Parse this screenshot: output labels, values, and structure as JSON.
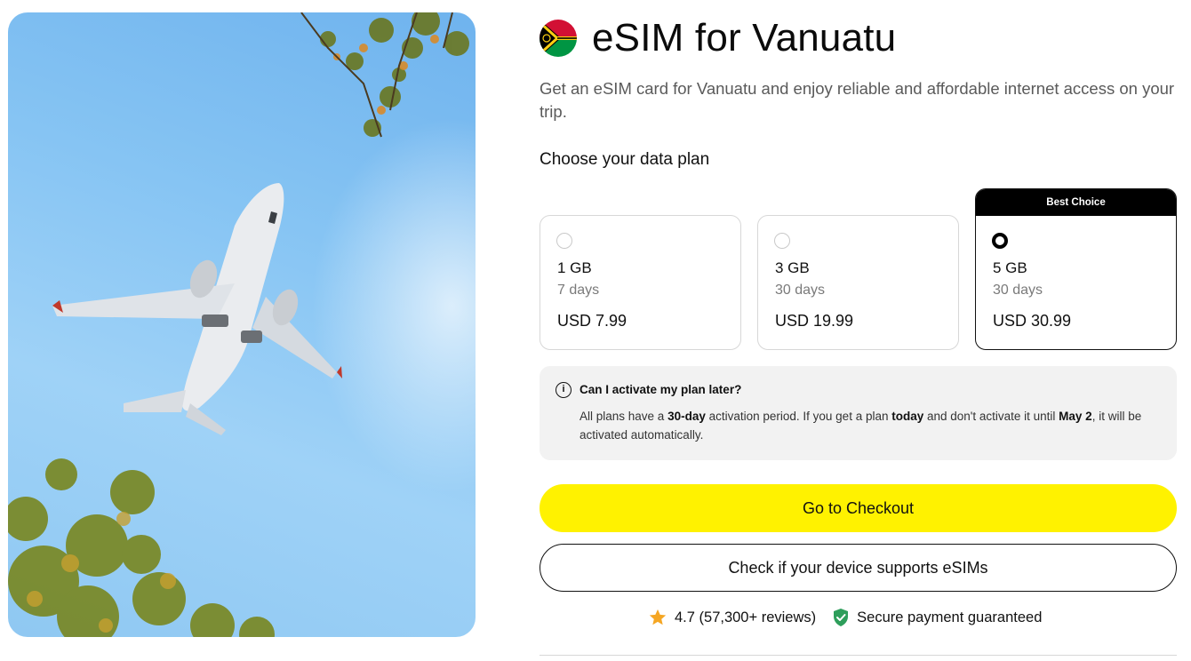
{
  "hero": {
    "image": "airplane-in-sky"
  },
  "header": {
    "flag": "vanuatu-flag-icon",
    "title": "eSIM for Vanuatu",
    "subtitle": "Get an eSIM card for Vanuatu and enjoy reliable and affordable internet access on your trip."
  },
  "plans": {
    "section_title": "Choose your data plan",
    "items": [
      {
        "data": "1 GB",
        "days": "7 days",
        "price": "USD 7.99",
        "selected": false
      },
      {
        "data": "3 GB",
        "days": "30 days",
        "price": "USD 19.99",
        "selected": false
      },
      {
        "data": "5 GB",
        "days": "30 days",
        "price": "USD 30.99",
        "selected": true,
        "badge": "Best Choice"
      }
    ]
  },
  "info": {
    "question": "Can I activate my plan later?",
    "answer_parts": {
      "p1": "All plans have a ",
      "b1": "30-day",
      "p2": " activation period. If you get a plan ",
      "b2": "today",
      "p3": " and don't activate it until ",
      "b3": "May 2",
      "p4": ", it will be activated automatically."
    }
  },
  "actions": {
    "checkout_label": "Go to Checkout",
    "check_device_label": "Check if your device supports eSIMs"
  },
  "trust": {
    "rating": "4.7 (57,300+ reviews)",
    "secure": "Secure payment guaranteed"
  },
  "colors": {
    "accent": "#fff200",
    "text": "#111111",
    "muted": "#7a7a7a",
    "info_bg": "#f2f2f2"
  }
}
